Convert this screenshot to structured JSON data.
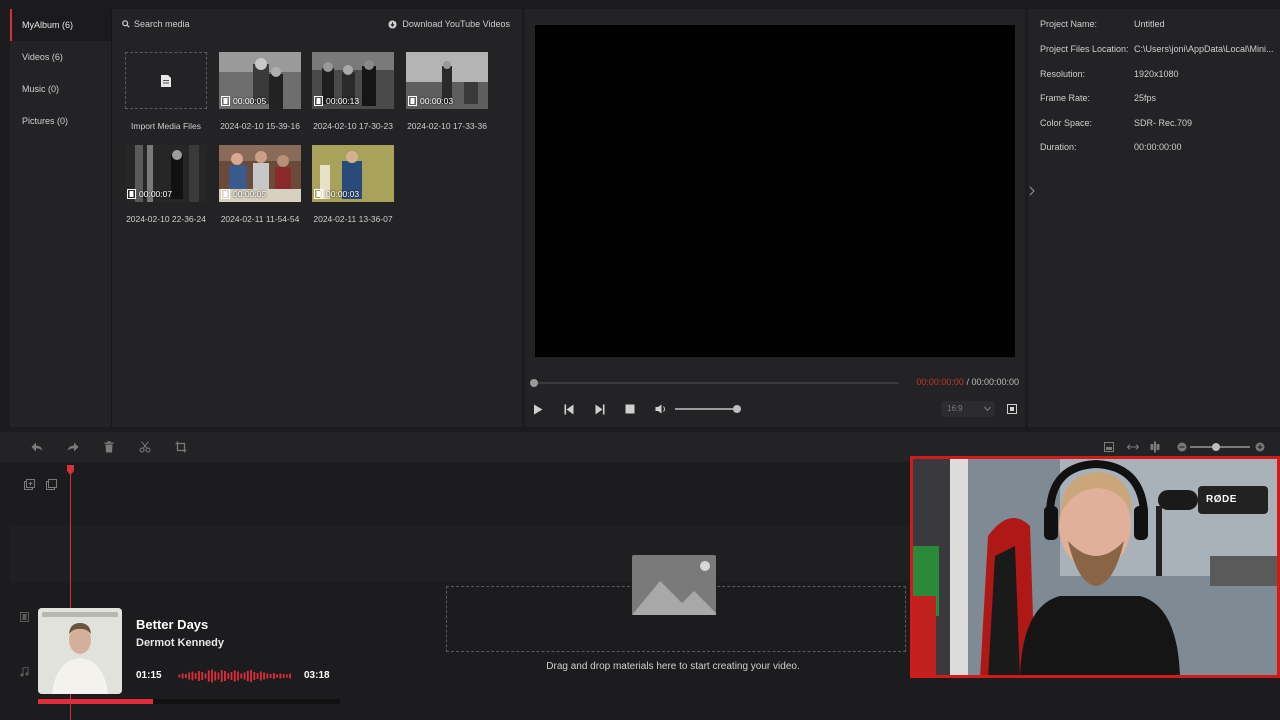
{
  "sidebar": {
    "items": [
      {
        "label": "MyAlbum (6)",
        "active": true
      },
      {
        "label": "Videos (6)"
      },
      {
        "label": "Music (0)"
      },
      {
        "label": "Pictures (0)"
      }
    ]
  },
  "media": {
    "search_placeholder": "Search media",
    "download_label": "Download YouTube Videos",
    "import_label": "Import Media Files",
    "tiles": [
      {
        "duration": "00:00:05",
        "name": "2024-02-10 15-39-16"
      },
      {
        "duration": "00:00:13",
        "name": "2024-02-10 17-30-23"
      },
      {
        "duration": "00:00:03",
        "name": "2024-02-10 17-33-36"
      },
      {
        "duration": "00:00:07",
        "name": "2024-02-10 22-36-24"
      },
      {
        "duration": "00:00:05",
        "name": "2024-02-11 11-54-54"
      },
      {
        "duration": "00:00:03",
        "name": "2024-02-11 13-36-07"
      }
    ]
  },
  "preview": {
    "time_current": "00:00:00:00",
    "time_separator": " / ",
    "time_total": "00:00:00:00",
    "aspect_ratio": "16:9"
  },
  "project_info": {
    "rows": [
      {
        "key": "Project Name:",
        "value": "Untitled"
      },
      {
        "key": "Project Files Location:",
        "value": "C:\\Users\\joni\\AppData\\Local\\Mini..."
      },
      {
        "key": "Resolution:",
        "value": "1920x1080"
      },
      {
        "key": "Frame Rate:",
        "value": "25fps"
      },
      {
        "key": "Color Space:",
        "value": "SDR- Rec.709"
      },
      {
        "key": "Duration:",
        "value": "00:00:00:00"
      }
    ]
  },
  "timeline": {
    "drop_text": "Drag and drop materials here to start creating your video."
  },
  "music_widget": {
    "title": "Better Days",
    "artist": "Dermot Kennedy",
    "elapsed": "01:15",
    "total": "03:18",
    "progress_fraction": 0.38,
    "accent": "#e02d3c"
  },
  "webcam": {
    "mic_brand": "RØDE",
    "border_color": "#d11a1a"
  },
  "colors": {
    "accent_red": "#d6303c",
    "panel_bg": "#232325",
    "app_bg": "#1c1c1e"
  }
}
